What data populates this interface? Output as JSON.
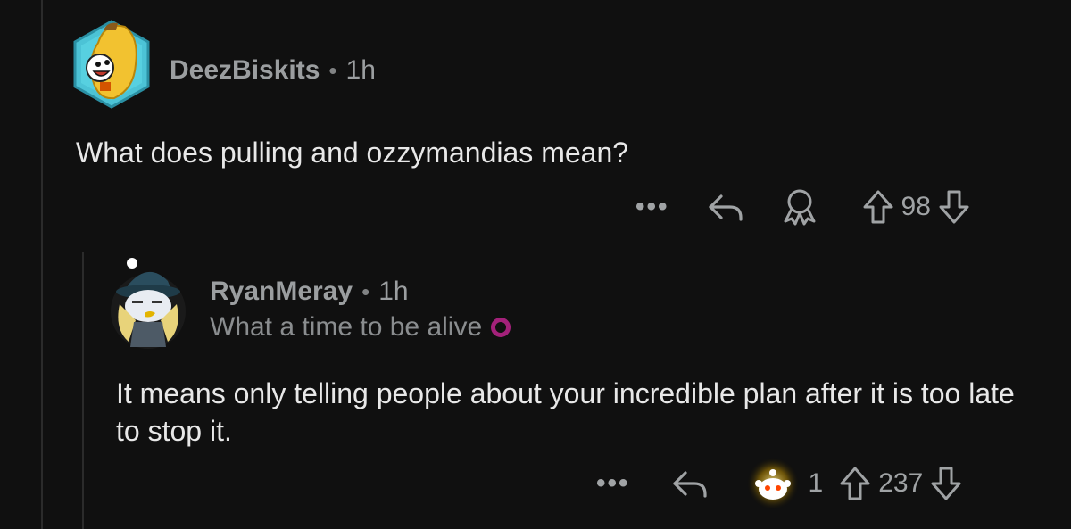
{
  "comments": [
    {
      "author": "DeezBiskits",
      "time": "1h",
      "body": "What does pulling and ozzymandias mean?",
      "votes": "98",
      "avatar_icon": "banana-avatar-icon"
    },
    {
      "author": "RyanMeray",
      "time": "1h",
      "flair": "What a time to be alive",
      "flair_color": "#a3217a",
      "body": "It means only telling people about your incredible plan after it is too late to stop it.",
      "award_count": "1",
      "votes": "237",
      "avatar_icon": "snoo-hat-avatar-icon"
    }
  ],
  "separator": "•",
  "more_label": "•••"
}
